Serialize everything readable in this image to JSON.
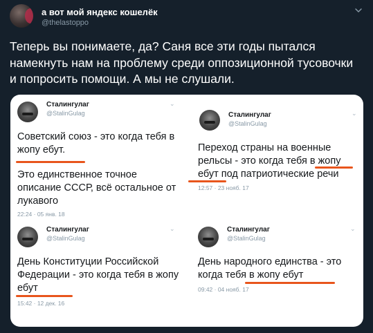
{
  "author": {
    "display_name": "а вот мой яндекс кошелёк",
    "handle": "@thelastoppo"
  },
  "tweet": {
    "text": "Теперь вы понимаете, да? Саня все эти годы пытался намекнуть нам на проблему среди оппозиционной тусовочки и попросить помощи. А мы не слушали."
  },
  "media": {
    "cards": [
      {
        "name": "Сталингулаг",
        "handle": "@StalinGulag",
        "text1": "Советский союз - это когда тебя в жопу ебут.",
        "text2": "Это единственное точное описание СССР, всё остальное от лукавого",
        "time": "22:24 · 05 янв. 18"
      },
      {
        "name": "Сталингулаг",
        "handle": "@StalinGulag",
        "text": "Переход страны на военные рельсы - это когда тебя в жопу ебут под патриотические речи",
        "time": "12:57 · 23 нояб. 17"
      },
      {
        "name": "Сталингулаг",
        "handle": "@StalinGulag",
        "text": "День Конституции Российской Федерации - это когда тебя в жопу ебут",
        "time": "15:42 · 12 дек. 16"
      },
      {
        "name": "Сталингулаг",
        "handle": "@StalinGulag",
        "text": "День народного единства - это когда тебя в жопу ебут",
        "time": "09:42 · 04 нояб. 17"
      }
    ]
  },
  "colors": {
    "background": "#15202b",
    "highlight_underline": "#e8551c",
    "secondary_text": "#8899a6"
  },
  "icons": {
    "menu": "chevron-down-icon",
    "card_menu": "chevron-down-icon"
  }
}
